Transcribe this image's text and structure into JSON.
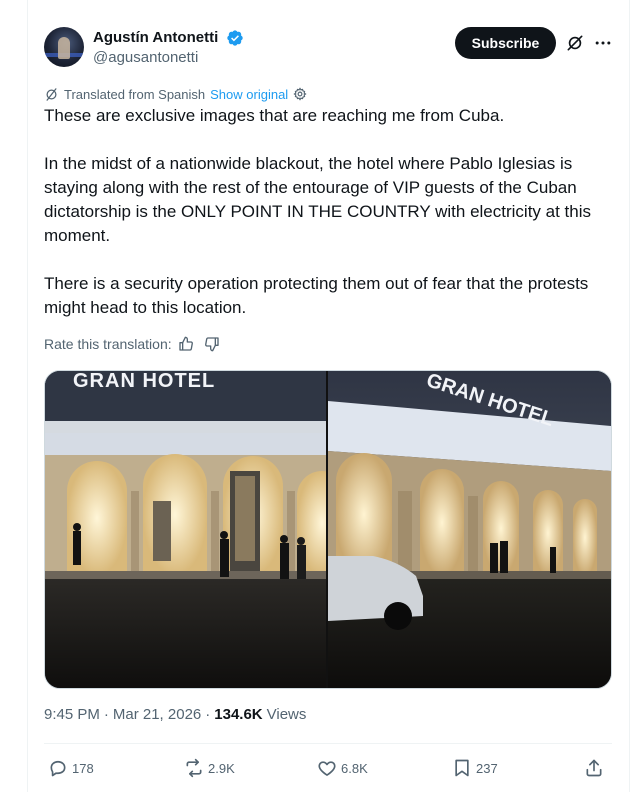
{
  "author": {
    "name": "Agustín Antonetti",
    "handle": "@agusantonetti"
  },
  "header": {
    "subscribe_label": "Subscribe"
  },
  "translation": {
    "label": "Translated from Spanish",
    "show_original": "Show original",
    "rate_label": "Rate this translation:"
  },
  "tweet": {
    "paragraphs": [
      "These are exclusive images that are reaching me from Cuba.",
      "In the midst of a nationwide blackout, the hotel where Pablo Iglesias is staying along with the rest of the entourage of VIP guests of the Cuban dictatorship is the ONLY POINT IN THE COUNTRY with electricity at this moment.",
      "There is a security operation protecting them out of fear that the protests might head to this location."
    ]
  },
  "media": {
    "left_sign": "GRAN HOTEL",
    "right_sign": "GRAN HOTEL"
  },
  "meta": {
    "time": "9:45 PM",
    "separator": "·",
    "date": "Mar 21, 2026",
    "separator2": "·",
    "views_count": "134.6K",
    "views_label": "Views"
  },
  "actions": {
    "replies": "178",
    "reposts": "2.9K",
    "likes": "6.8K",
    "bookmarks": "237"
  },
  "icons": {
    "verified": "verified-badge-icon",
    "grok": "grok-icon",
    "more": "more-icon",
    "translate": "translate-icon",
    "settings": "settings-icon",
    "thumbs_up": "thumbs-up-icon",
    "thumbs_down": "thumbs-down-icon",
    "reply": "reply-icon",
    "repost": "repost-icon",
    "like": "heart-icon",
    "bookmark": "bookmark-icon",
    "share": "share-icon"
  },
  "colors": {
    "accent": "#1d9bf0",
    "text": "#0f1419",
    "muted": "#536471",
    "button_bg": "#0f1419"
  }
}
